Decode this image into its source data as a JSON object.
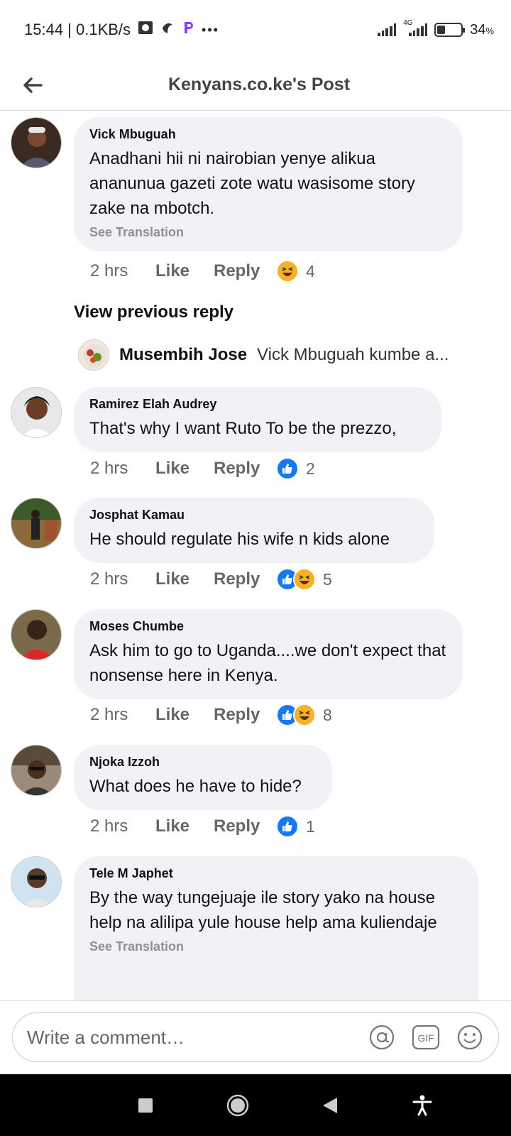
{
  "status_bar": {
    "time_speed": "15:44 | 0.1KB/s",
    "network": "4G",
    "battery_percent": "34",
    "battery_level": 0.34,
    "battery_suffix": "%",
    "more": "•••"
  },
  "header": {
    "title": "Kenyans.co.ke's Post"
  },
  "comments": [
    {
      "author": "Vick Mbuguah",
      "text": "Anadhani hii ni nairobian yenye alikua ananunua gazeti zote watu wasisome story zake na mbotch.",
      "see_translation": "See Translation",
      "time": "2 hrs",
      "like_label": "Like",
      "reply_label": "Reply",
      "reactions": [
        "haha"
      ],
      "reaction_count": "4"
    },
    {
      "author": "Ramirez Elah Audrey",
      "text": "That's why I want Ruto To be  the prezzo,",
      "time": "2 hrs",
      "like_label": "Like",
      "reply_label": "Reply",
      "reactions": [
        "like"
      ],
      "reaction_count": "2"
    },
    {
      "author": "Josphat Kamau",
      "text": "He should regulate his wife n kids alone",
      "time": "2 hrs",
      "like_label": "Like",
      "reply_label": "Reply",
      "reactions": [
        "like",
        "haha"
      ],
      "reaction_count": "5"
    },
    {
      "author": "Moses Chumbe",
      "text": "Ask him to go to Uganda....we don't expect that nonsense here in Kenya.",
      "time": "2 hrs",
      "like_label": "Like",
      "reply_label": "Reply",
      "reactions": [
        "like",
        "haha"
      ],
      "reaction_count": "8"
    },
    {
      "author": "Njoka Izzoh",
      "text": "What does he have to hide?",
      "time": "2 hrs",
      "like_label": "Like",
      "reply_label": "Reply",
      "reactions": [
        "like"
      ],
      "reaction_count": "1"
    },
    {
      "author": "Tele M Japhet",
      "text": "By the way tungejuaje ile story yako na house help   na  alilipa yule house help ama kuliendaje",
      "see_translation": "See Translation"
    }
  ],
  "view_previous_reply": "View previous reply",
  "reply_preview": {
    "author": "Musembih Jose",
    "snippet": "Vick Mbuguah kumbe a..."
  },
  "composer": {
    "placeholder": "Write a comment…",
    "icons": [
      "mention-icon",
      "gif-icon",
      "emoji-icon"
    ],
    "gif_label": "GIF"
  },
  "colors": {
    "like_blue": "#1877f2",
    "haha_yellow": "#f7b125",
    "bubble_bg": "#f0f2f5"
  }
}
